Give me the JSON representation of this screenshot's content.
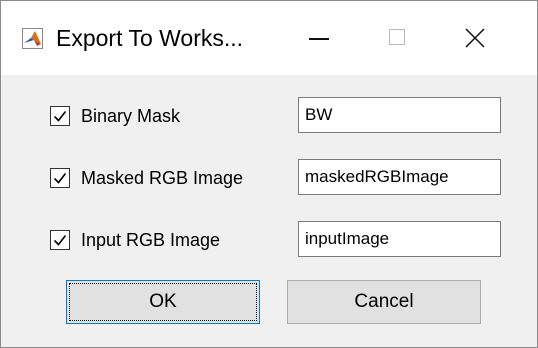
{
  "window": {
    "title": "Export To Works...",
    "app_icon": "matlab-icon",
    "controls": {
      "minimize": "minimize-icon",
      "maximize": "maximize-icon",
      "close": "close-icon"
    }
  },
  "rows": [
    {
      "checked": true,
      "label": "Binary Mask",
      "value": "BW"
    },
    {
      "checked": true,
      "label": "Masked RGB Image",
      "value": "maskedRGBImage"
    },
    {
      "checked": true,
      "label": "Input RGB Image",
      "value": "inputImage"
    }
  ],
  "buttons": {
    "ok_label": "OK",
    "cancel_label": "Cancel"
  },
  "colors": {
    "dialog_background": "#f0f0f0",
    "titlebar_background": "#ffffff",
    "focus_border": "#0078d7",
    "button_face": "#e1e1e1"
  }
}
